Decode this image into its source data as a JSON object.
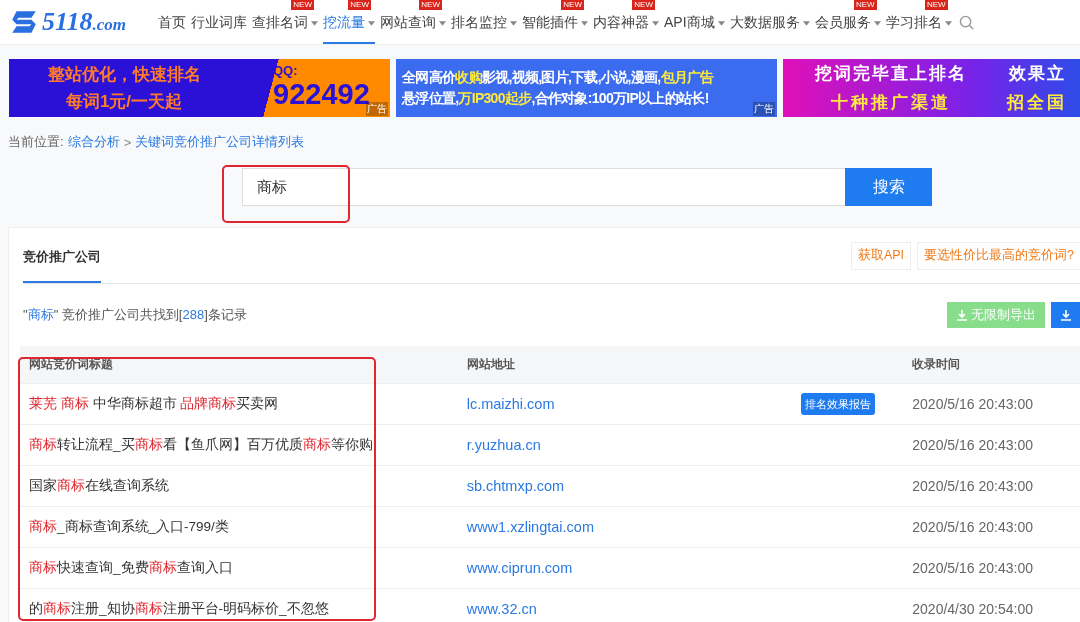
{
  "nav": {
    "logo": {
      "main": "5118",
      "suffix": ".com"
    },
    "items": [
      {
        "label": "首页",
        "dropdown": false,
        "selected": false
      },
      {
        "label": "行业词库",
        "dropdown": false,
        "selected": false
      },
      {
        "label": "查排名词",
        "dropdown": true,
        "badge": "NEW",
        "selected": false
      },
      {
        "label": "挖流量",
        "dropdown": true,
        "badge": "NEW",
        "selected": true
      },
      {
        "label": "网站查询",
        "dropdown": true,
        "badge": "NEW",
        "selected": false
      },
      {
        "label": "排名监控",
        "dropdown": true,
        "selected": false
      },
      {
        "label": "智能插件",
        "dropdown": true,
        "badge": "NEW",
        "selected": false
      },
      {
        "label": "内容神器",
        "dropdown": true,
        "badge": "NEW",
        "selected": false
      },
      {
        "label": "API商城",
        "dropdown": true,
        "selected": false
      },
      {
        "label": "大数据服务",
        "dropdown": true,
        "selected": false
      },
      {
        "label": "会员服务",
        "dropdown": true,
        "badge": "NEW",
        "selected": false
      },
      {
        "label": "学习排名",
        "dropdown": true,
        "badge": "NEW",
        "selected": false
      }
    ]
  },
  "ads": [
    {
      "kind": "split",
      "lines": [
        "整站优化，快速排名",
        "每词1元/一天起"
      ],
      "qq_label": "QQ:",
      "qq": "922492",
      "tag": "广告"
    },
    {
      "kind": "text",
      "lines": [
        [
          {
            "t": "全网高价",
            "hl": false
          },
          {
            "t": "收购",
            "hl": true
          },
          {
            "t": "影视,视频,图片,下载,小说,漫画,",
            "hl": false
          },
          {
            "t": "包月广告",
            "hl": true
          }
        ],
        [
          {
            "t": "悬浮位置,",
            "hl": false
          },
          {
            "t": "万IP300起步",
            "hl": true
          },
          {
            "t": ",合作对象:100万IP以上的站长!",
            "hl": false
          }
        ]
      ],
      "tag": "广告"
    },
    {
      "kind": "columns",
      "columns": [
        {
          "top": "挖词完毕直上排名",
          "bottom": "十种推广渠道"
        },
        {
          "top": "效果立",
          "bottom": "招全国"
        }
      ]
    }
  ],
  "breadcrumb": {
    "label": "当前位置:",
    "links": [
      "综合分析",
      "关键词竞价推广公司详情列表"
    ],
    "separator": ">"
  },
  "search": {
    "value": "商标",
    "button": "搜索"
  },
  "panel": {
    "tabs": [
      {
        "label": "竞价推广公司",
        "selected": true
      }
    ],
    "actions": [
      "获取API",
      "要选性价比最高的竞价词?"
    ],
    "summary": [
      {
        "t": "\"",
        "hl": false
      },
      {
        "t": "商标",
        "hl": true
      },
      {
        "t": "\" 竞价推广公司共找到[",
        "hl": false
      },
      {
        "t": "288",
        "hl": true
      },
      {
        "t": "]条记录",
        "hl": false
      }
    ],
    "export": "无限制导出"
  },
  "table": {
    "columns": [
      "网站竞价词标题",
      "网站地址",
      "收录时间"
    ],
    "rows": [
      {
        "title": [
          {
            "t": "莱芜 商标",
            "hl": true
          },
          {
            "t": " 中华商标超市 ",
            "hl": false
          },
          {
            "t": "品牌商标",
            "hl": true
          },
          {
            "t": "买卖网",
            "hl": false
          }
        ],
        "url": "lc.maizhi.com",
        "report": "排名效果报告",
        "time": "2020/5/16 20:43:00"
      },
      {
        "title": [
          {
            "t": "商标",
            "hl": true
          },
          {
            "t": "转让流程_买",
            "hl": false
          },
          {
            "t": "商标",
            "hl": true
          },
          {
            "t": "看【鱼爪网】百万优质",
            "hl": false
          },
          {
            "t": "商标",
            "hl": true
          },
          {
            "t": "等你购",
            "hl": false
          }
        ],
        "url": "r.yuzhua.cn",
        "time": "2020/5/16 20:43:00"
      },
      {
        "title": [
          {
            "t": "国家",
            "hl": false
          },
          {
            "t": "商标",
            "hl": true
          },
          {
            "t": "在线查询系统",
            "hl": false
          }
        ],
        "url": "sb.chtmxp.com",
        "time": "2020/5/16 20:43:00"
      },
      {
        "title": [
          {
            "t": "商标",
            "hl": true
          },
          {
            "t": "_商标查询系统_入口-799/类",
            "hl": false
          }
        ],
        "url": "www1.xzlingtai.com",
        "time": "2020/5/16 20:43:00"
      },
      {
        "title": [
          {
            "t": "商标",
            "hl": true
          },
          {
            "t": "快速查询_免费",
            "hl": false
          },
          {
            "t": "商标",
            "hl": true
          },
          {
            "t": "查询入口",
            "hl": false
          }
        ],
        "url": "www.ciprun.com",
        "time": "2020/5/16 20:43:00"
      },
      {
        "title": [
          {
            "t": "的",
            "hl": false
          },
          {
            "t": "商标",
            "hl": true
          },
          {
            "t": "注册_知协",
            "hl": false
          },
          {
            "t": "商标",
            "hl": true
          },
          {
            "t": "注册平台-明码标价_不忽悠",
            "hl": false
          }
        ],
        "url": "www.32.cn",
        "time": "2020/4/30 20:54:00"
      }
    ]
  }
}
